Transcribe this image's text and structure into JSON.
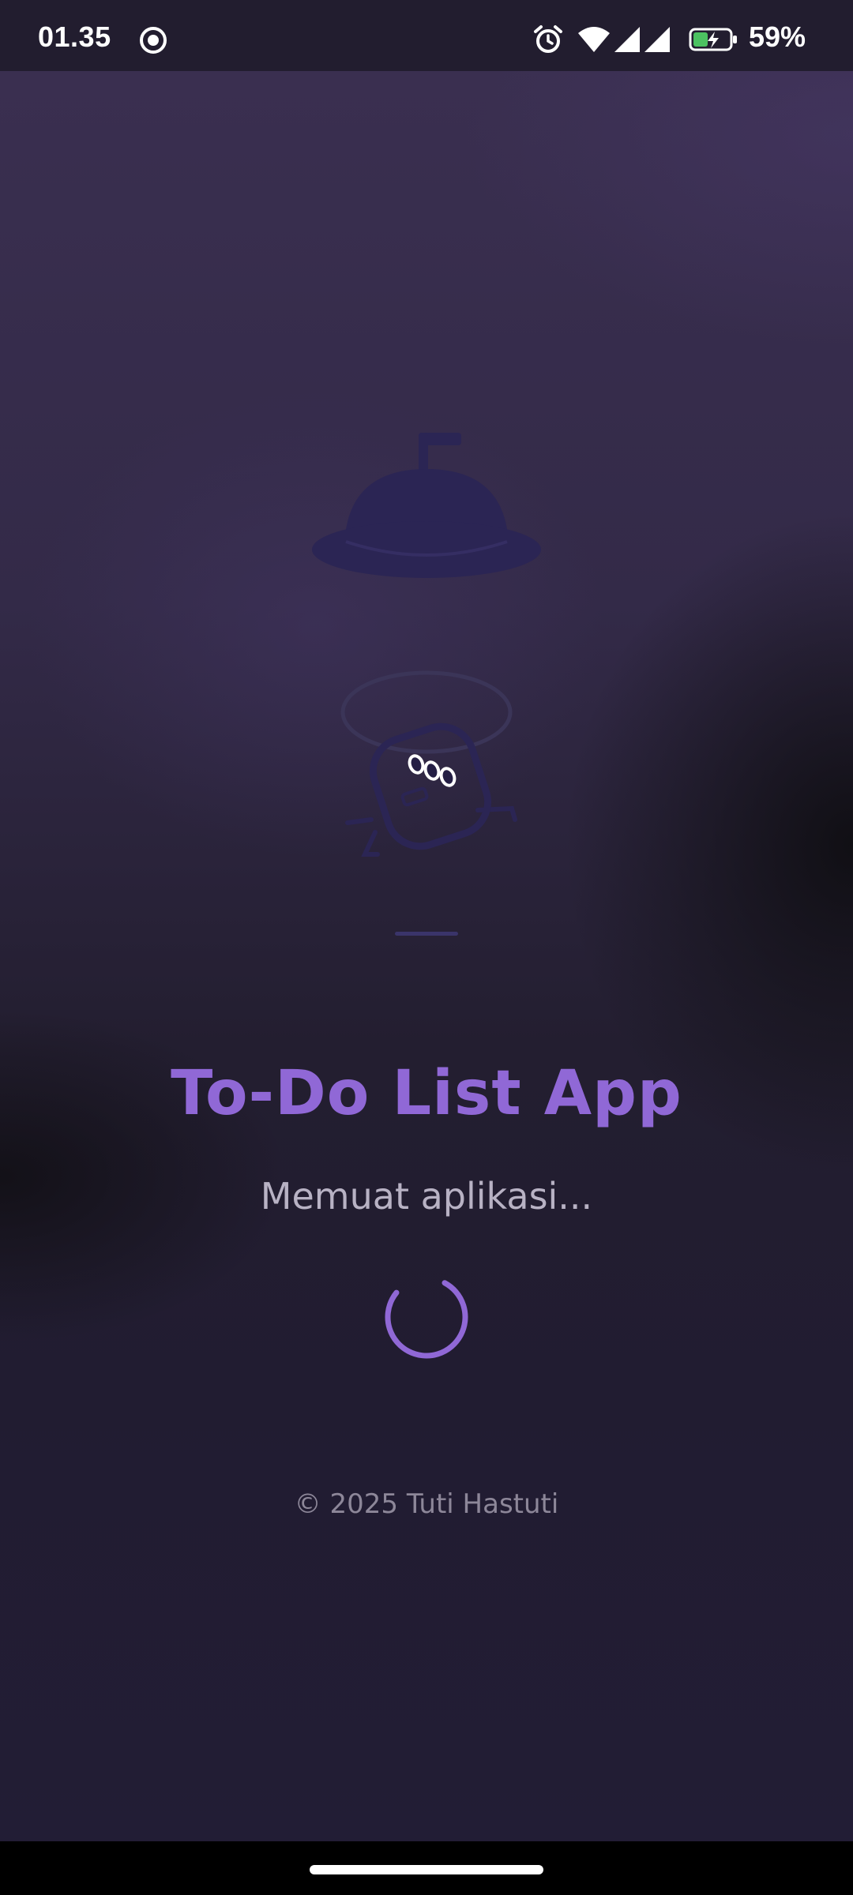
{
  "status_bar": {
    "time": "01.35",
    "battery_percent": "59%",
    "icons": [
      "screen-record-icon",
      "alarm-icon",
      "wifi-icon",
      "signal-icon",
      "signal-icon",
      "battery-charging-icon"
    ]
  },
  "splash": {
    "title": "To-Do List App",
    "loading_text": "Memuat aplikasi...",
    "copyright": "© 2025 Tuti Hastuti",
    "illustration": "service-bell-mascot-illustration",
    "spinner": "loading-spinner"
  },
  "colors": {
    "accent": "#9068d6",
    "background": "#221e33",
    "text_secondary": "#b8b2c4",
    "text_muted": "#8d8799"
  }
}
